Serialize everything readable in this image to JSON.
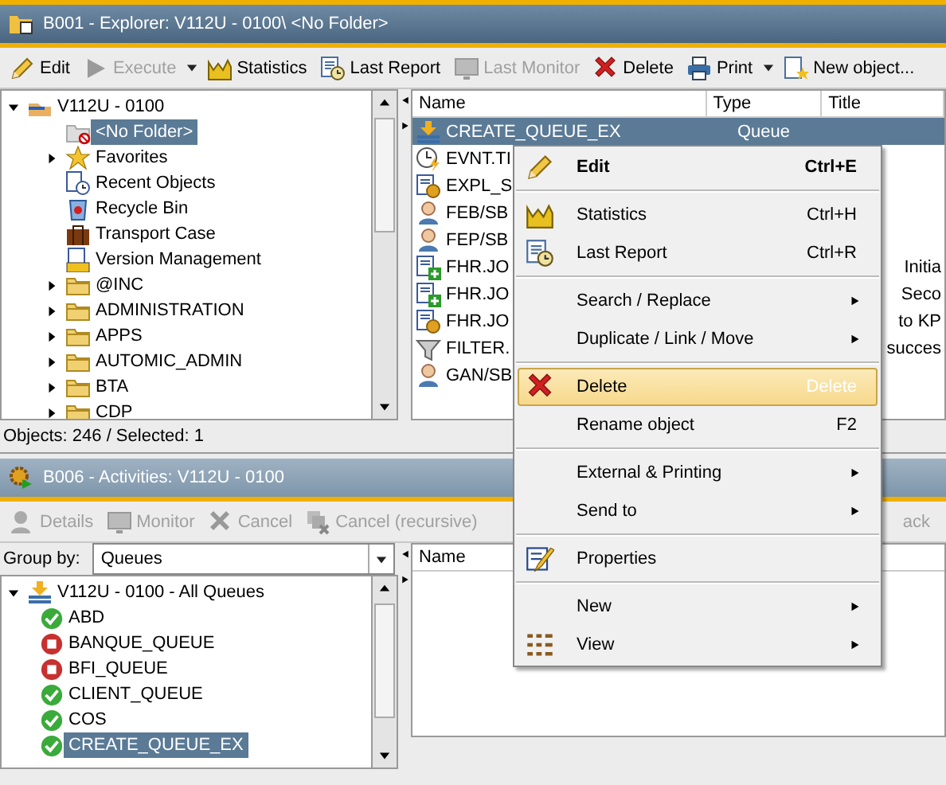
{
  "explorer": {
    "title": "B001 - Explorer: V112U - 0100\\ <No Folder>",
    "toolbar": [
      {
        "label": "Edit",
        "disabled": false,
        "dropdown": false
      },
      {
        "label": "Execute",
        "disabled": true,
        "dropdown": true
      },
      {
        "label": "Statistics",
        "disabled": false,
        "dropdown": false
      },
      {
        "label": "Last Report",
        "disabled": false,
        "dropdown": false
      },
      {
        "label": "Last Monitor",
        "disabled": true,
        "dropdown": false
      },
      {
        "label": "Delete",
        "disabled": false,
        "dropdown": false
      },
      {
        "label": "Print",
        "disabled": false,
        "dropdown": true
      },
      {
        "label": "New object...",
        "disabled": false,
        "dropdown": false
      }
    ],
    "tree": [
      {
        "label": "V112U - 0100",
        "kind": "client",
        "expanded": true,
        "selected": false,
        "children": [
          {
            "label": "<No Folder>",
            "kind": "nofolder",
            "selected": true
          },
          {
            "label": "Favorites",
            "kind": "favorites",
            "expanded": false,
            "selected": false
          },
          {
            "label": "Recent Objects",
            "kind": "recent",
            "selected": false
          },
          {
            "label": "Recycle Bin",
            "kind": "recycle",
            "selected": false
          },
          {
            "label": "Transport Case",
            "kind": "transport",
            "selected": false
          },
          {
            "label": "Version Management",
            "kind": "version",
            "selected": false
          },
          {
            "label": "@INC",
            "kind": "folder",
            "expanded": false,
            "selected": false
          },
          {
            "label": "ADMINISTRATION",
            "kind": "folder",
            "expanded": false,
            "selected": false
          },
          {
            "label": "APPS",
            "kind": "folder",
            "expanded": false,
            "selected": false
          },
          {
            "label": "AUTOMIC_ADMIN",
            "kind": "folder",
            "expanded": false,
            "selected": false
          },
          {
            "label": "BTA",
            "kind": "folder",
            "expanded": false,
            "selected": false
          },
          {
            "label": "CDP",
            "kind": "folder",
            "expanded": false,
            "selected": false
          }
        ]
      }
    ],
    "table": {
      "columns": [
        "Name",
        "Type",
        "Title"
      ],
      "rows": [
        {
          "name": "CREATE_QUEUE_EX",
          "type": "Queue",
          "kind": "queue",
          "selected": true
        },
        {
          "name": "EVNT.TI",
          "kind": "event",
          "selected": false
        },
        {
          "name": "EXPL_S",
          "kind": "job",
          "selected": false
        },
        {
          "name": "FEB/SB",
          "kind": "user",
          "selected": false
        },
        {
          "name": "FEP/SB",
          "kind": "user",
          "selected": false
        },
        {
          "name": "FHR.JO",
          "kind": "include",
          "title": "Initia",
          "selected": false
        },
        {
          "name": "FHR.JO",
          "kind": "include",
          "title": "Seco",
          "selected": false
        },
        {
          "name": "FHR.JO",
          "kind": "job",
          "title": "to KP",
          "selected": false
        },
        {
          "name": "FILTER.",
          "kind": "filter",
          "title": "succes",
          "selected": false
        },
        {
          "name": "GAN/SB",
          "kind": "user",
          "selected": false
        }
      ]
    },
    "status_bar": "Objects: 246  / Selected: 1"
  },
  "activities": {
    "title": "B006 - Activities: V112U - 0100",
    "toolbar": [
      {
        "label": "Details",
        "disabled": true,
        "dropdown": false
      },
      {
        "label": "Monitor",
        "disabled": true,
        "dropdown": false
      },
      {
        "label": "Cancel",
        "disabled": true,
        "dropdown": false
      },
      {
        "label": "Cancel (recursive)",
        "disabled": true,
        "dropdown": false
      },
      {
        "label": "ack",
        "disabled": true,
        "dropdown": false
      }
    ],
    "group_by": {
      "label": "Group by:",
      "value": "Queues"
    },
    "tree": [
      {
        "label": "V112U - 0100 - All Queues",
        "expanded": true,
        "children": [
          {
            "label": "ABD",
            "kind": "running",
            "selected": false
          },
          {
            "label": "BANQUE_QUEUE",
            "kind": "stopped",
            "selected": false
          },
          {
            "label": "BFI_QUEUE",
            "kind": "stopped",
            "selected": false
          },
          {
            "label": "CLIENT_QUEUE",
            "kind": "running",
            "selected": false
          },
          {
            "label": "COS",
            "kind": "running",
            "selected": false
          },
          {
            "label": "CREATE_QUEUE_EX",
            "kind": "running",
            "selected": true
          }
        ]
      }
    ],
    "table": {
      "columns": [
        "Name"
      ]
    }
  },
  "context_menu": {
    "groups": [
      [
        {
          "label": "Edit",
          "shortcut": "Ctrl+E",
          "default": true,
          "selected": false,
          "submenu": false
        }
      ],
      [
        {
          "label": "Statistics",
          "shortcut": "Ctrl+H",
          "default": false,
          "selected": false,
          "submenu": false
        },
        {
          "label": "Last Report",
          "shortcut": "Ctrl+R",
          "default": false,
          "selected": false,
          "submenu": false
        }
      ],
      [
        {
          "label": "Search / Replace",
          "default": false,
          "selected": false,
          "submenu": true
        },
        {
          "label": "Duplicate / Link / Move",
          "default": false,
          "selected": false,
          "submenu": true
        }
      ],
      [
        {
          "label": "Delete",
          "shortcut": "Delete",
          "default": false,
          "selected": true,
          "submenu": false
        },
        {
          "label": "Rename object",
          "shortcut": "F2",
          "default": false,
          "selected": false,
          "submenu": false
        }
      ],
      [
        {
          "label": "External & Printing",
          "default": false,
          "selected": false,
          "submenu": true
        },
        {
          "label": "Send to",
          "default": false,
          "selected": false,
          "submenu": true
        }
      ],
      [
        {
          "label": "Properties",
          "default": false,
          "selected": false,
          "submenu": false
        }
      ],
      [
        {
          "label": "New",
          "default": false,
          "selected": false,
          "submenu": true
        },
        {
          "label": "View",
          "default": false,
          "selected": false,
          "submenu": true
        }
      ]
    ]
  }
}
